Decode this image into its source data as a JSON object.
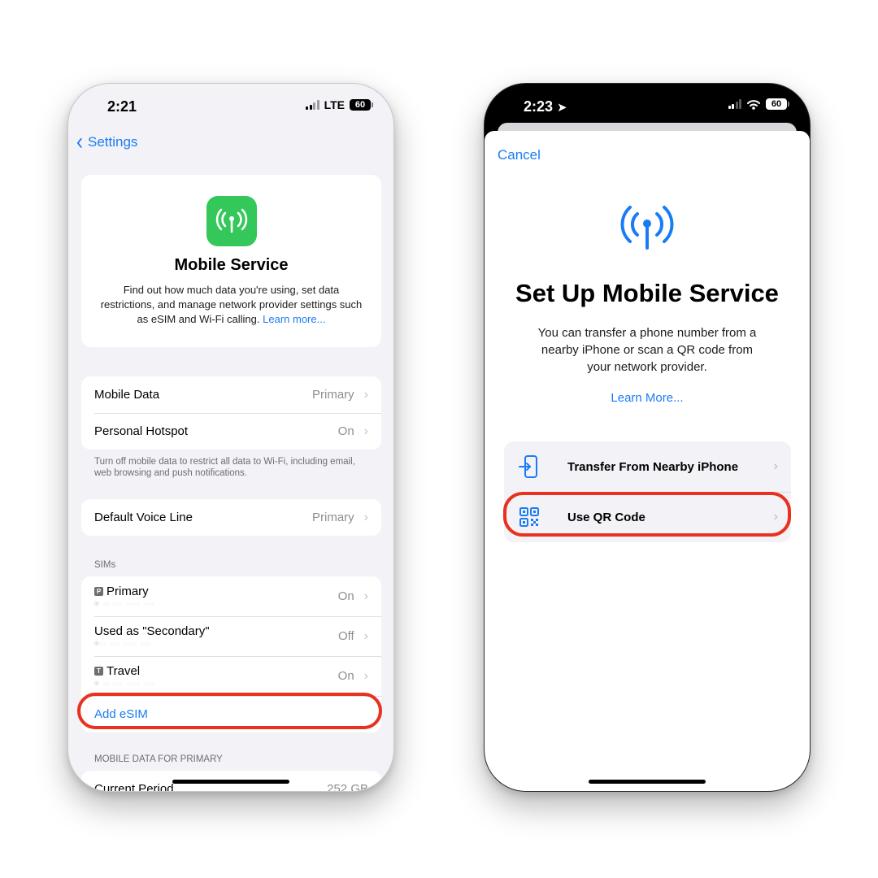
{
  "left_phone": {
    "status": {
      "time": "2:21",
      "network": "LTE",
      "battery": "60"
    },
    "nav": {
      "back_label": "Settings"
    },
    "hero": {
      "title": "Mobile Service",
      "description": "Find out how much data you're using, set data restrictions, and manage network provider settings such as eSIM and Wi-Fi calling.",
      "link": "Learn more..."
    },
    "data_group": [
      {
        "label": "Mobile Data",
        "value": "Primary"
      },
      {
        "label": "Personal Hotspot",
        "value": "On"
      }
    ],
    "data_footnote": "Turn off mobile data to restrict all data to Wi-Fi, including email, web browsing and push notifications.",
    "voice_group": [
      {
        "label": "Default Voice Line",
        "value": "Primary"
      }
    ],
    "sims_header": "SIMs",
    "sims": [
      {
        "tag": "P",
        "name": "Primary",
        "value": "On"
      },
      {
        "tag": "",
        "name": "Used as \"Secondary\"",
        "value": "Off"
      },
      {
        "tag": "T",
        "name": "Travel",
        "value": "On"
      }
    ],
    "add_esim": "Add eSIM",
    "usage_header": "MOBILE DATA FOR PRIMARY",
    "usage_row": {
      "label": "Current Period",
      "value": "252 GB"
    }
  },
  "right_phone": {
    "status": {
      "time": "2:23",
      "battery": "60"
    },
    "cancel": "Cancel",
    "title": "Set Up Mobile Service",
    "description": "You can transfer a phone number from a nearby iPhone or scan a QR code from your network provider.",
    "learn_more": "Learn More...",
    "options": [
      {
        "label": "Transfer From Nearby iPhone",
        "icon": "transfer-phone-icon"
      },
      {
        "label": "Use QR Code",
        "icon": "qr-code-icon"
      }
    ]
  },
  "colors": {
    "accent": "#1a7cf5",
    "highlight": "#e8311e",
    "app_icon": "#34c759"
  }
}
